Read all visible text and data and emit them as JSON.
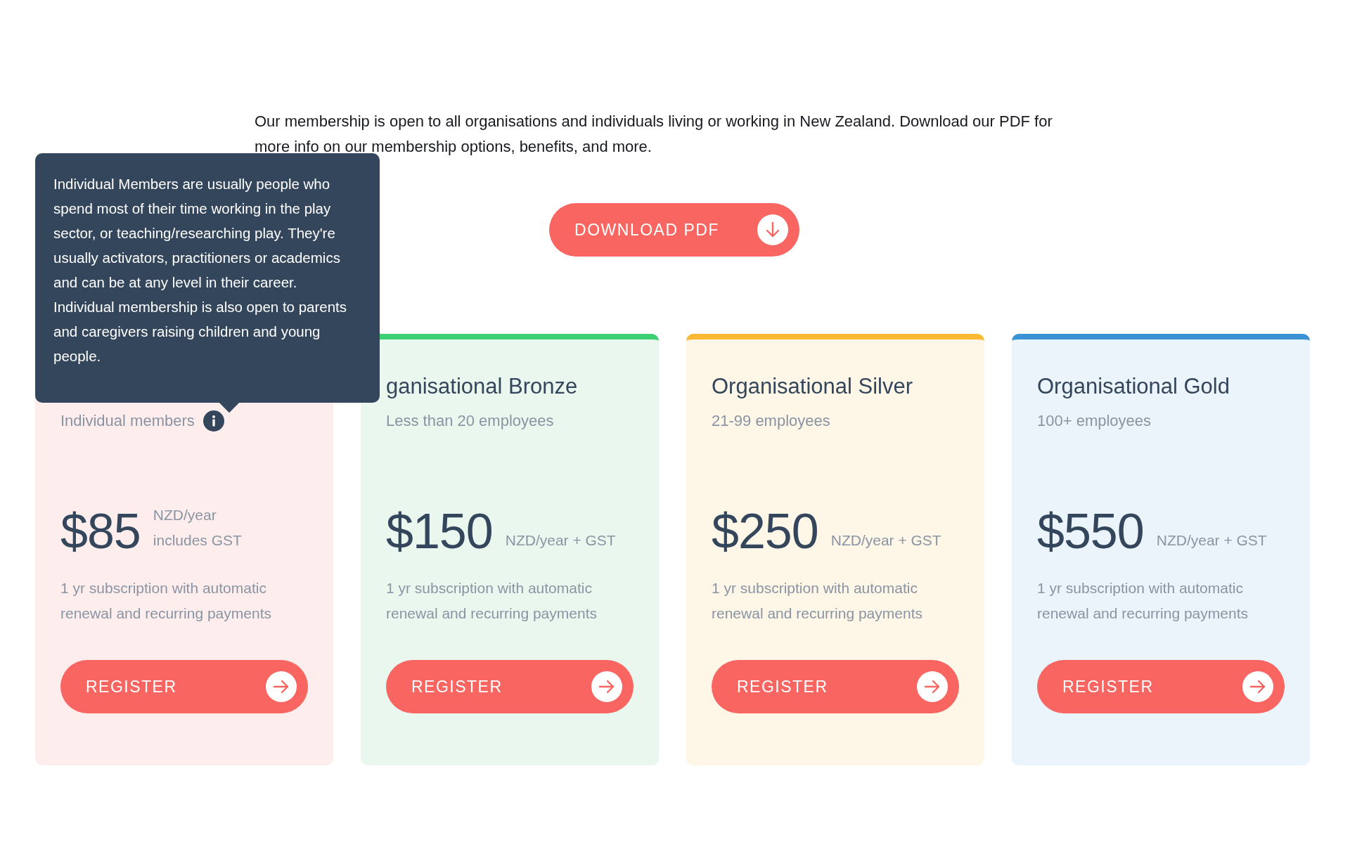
{
  "intro": "Our membership is open to all organisations and individuals living or working in New Zealand. Download our PDF for more info on our membership options, benefits, and more.",
  "download_button": {
    "label": "DOWNLOAD PDF"
  },
  "tooltip": {
    "text": "Individual Members are usually people who spend most of their time working in the play sector, or teaching/researching play. They're usually activators, practitioners or academics and can be at any level in their career. Individual membership is also open to parents and caregivers raising children and young people."
  },
  "plans": [
    {
      "kind": "individual",
      "subtitle": "Individual members",
      "info": true,
      "price": "$85",
      "unit_lines": [
        "NZD/year",
        "includes GST"
      ],
      "description": "1 yr subscription with automatic renewal and recurring payments",
      "button": "REGISTER"
    },
    {
      "kind": "bronze",
      "title": "ganisational Bronze",
      "subtitle": "Less than 20 employees",
      "info": false,
      "price": "$150",
      "unit_lines": [
        "NZD/year + GST"
      ],
      "description": "1 yr subscription with automatic renewal and recurring payments",
      "button": "REGISTER"
    },
    {
      "kind": "silver",
      "title": "Organisational Silver",
      "subtitle": "21-99 employees",
      "info": false,
      "price": "$250",
      "unit_lines": [
        "NZD/year + GST"
      ],
      "description": "1 yr subscription with automatic renewal and recurring payments",
      "button": "REGISTER"
    },
    {
      "kind": "gold",
      "title": "Organisational Gold",
      "subtitle": "100+ employees",
      "info": false,
      "price": "$550",
      "unit_lines": [
        "NZD/year + GST"
      ],
      "description": "1 yr subscription with automatic renewal and recurring payments",
      "button": "REGISTER"
    }
  ]
}
